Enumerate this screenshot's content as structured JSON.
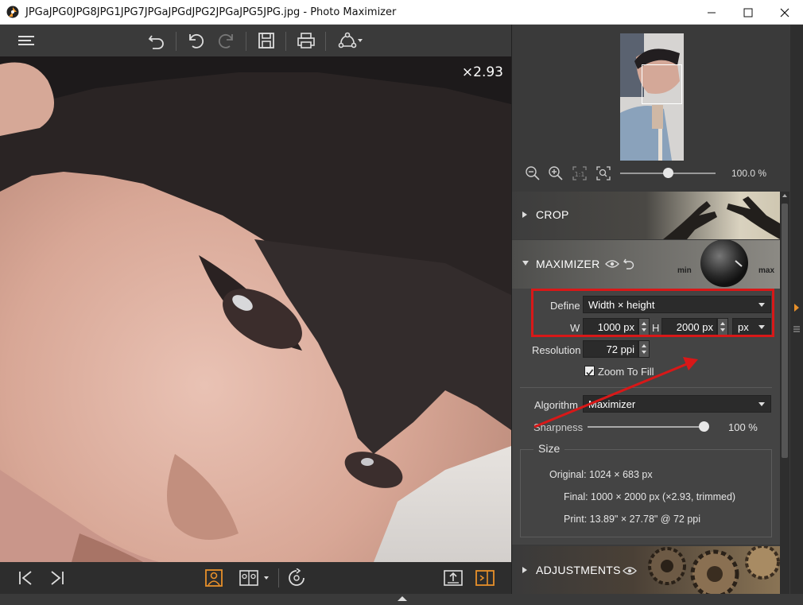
{
  "window": {
    "title": "JPGaJPG0JPG8JPG1JPG7JPGaJPGdJPG2JPGaJPG5JPG.jpg - Photo Maximizer"
  },
  "viewer": {
    "zoom_factor": "×2.93"
  },
  "navigator": {
    "zoom_percent": "100.0 %",
    "zoom_slider_fraction": 0.5
  },
  "sections": {
    "crop": "CROP",
    "maximizer": "MAXIMIZER",
    "adjustments": "ADJUSTMENTS"
  },
  "maximizer": {
    "min_label": "min",
    "max_label": "max",
    "define_label": "Define",
    "define_value": "Width × height",
    "w_label": "W",
    "w_value": "1000 px",
    "h_label": "H",
    "h_value": "2000 px",
    "unit_value": "px",
    "resolution_label": "Resolution",
    "resolution_value": "72 ppi",
    "zoom_to_fill_label": "Zoom To Fill",
    "zoom_to_fill_checked": true,
    "algorithm_label": "Algorithm",
    "algorithm_value": "Maximizer",
    "sharpness_label": "Sharpness",
    "sharpness_value": "100 %",
    "sharpness_fraction": 1.0
  },
  "size": {
    "title": "Size",
    "original": "Original: 1024 × 683 px",
    "final": "Final: 1000 × 2000 px (×2.93, trimmed)",
    "print": "Print: 13.89\" × 27.78\" @ 72 ppi"
  },
  "colors": {
    "accent": "#e8902a",
    "highlight": "#d81818"
  }
}
